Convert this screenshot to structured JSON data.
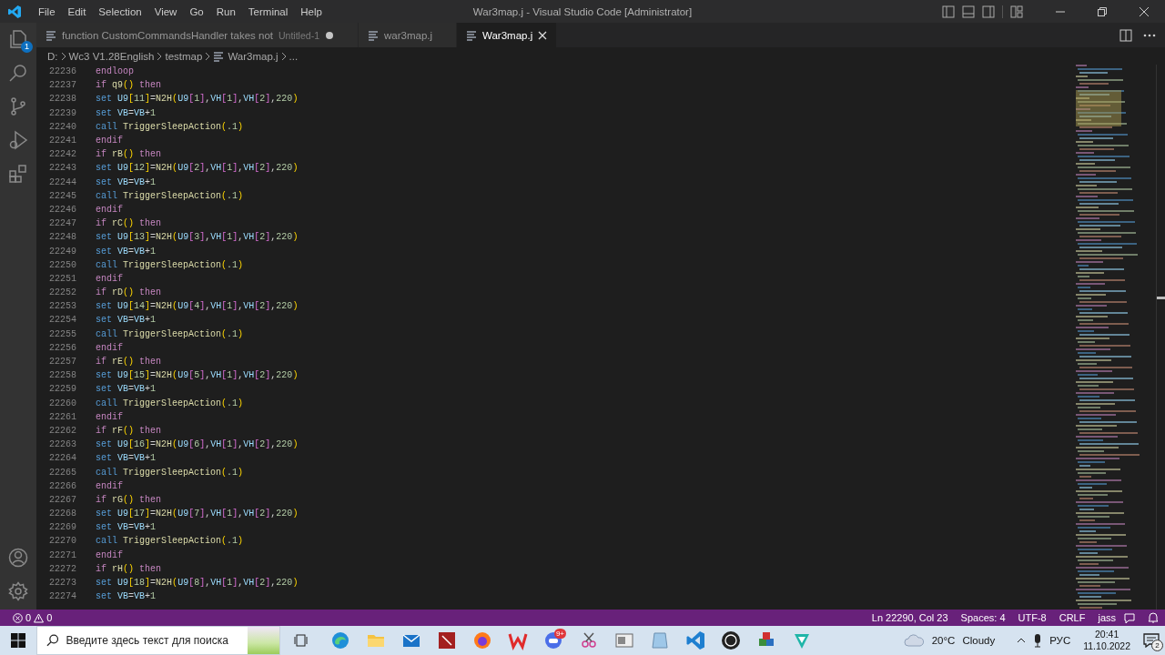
{
  "titlebar": {
    "menu": [
      "File",
      "Edit",
      "Selection",
      "View",
      "Go",
      "Run",
      "Terminal",
      "Help"
    ],
    "title": "War3map.j - Visual Studio Code [Administrator]"
  },
  "activity_bar": {
    "explorer_badge": "1"
  },
  "tabs": [
    {
      "label": "function CustomCommandsHandler takes not",
      "description": "Untitled-1",
      "dirty": true,
      "selected": false
    },
    {
      "label": "war3map.j",
      "dirty": false,
      "selected": false
    },
    {
      "label": "War3map.j",
      "dirty": false,
      "selected": true
    }
  ],
  "breadcrumb": [
    {
      "kind": "folder",
      "text": "D:"
    },
    {
      "kind": "folder",
      "text": "Wc3 V1.28English"
    },
    {
      "kind": "folder",
      "text": "testmap"
    },
    {
      "kind": "file",
      "text": "War3map.j"
    },
    {
      "kind": "more",
      "text": "..."
    }
  ],
  "editor": {
    "lines": [
      {
        "number": "22236",
        "tokens": [
          {
            "kind": "ctl",
            "text": "endloop"
          }
        ]
      },
      {
        "number": "22237",
        "tokens": [
          {
            "kind": "ctl",
            "text": "if "
          },
          {
            "kind": "fn",
            "text": "q9"
          },
          {
            "kind": "br1",
            "text": "()"
          },
          {
            "kind": "ctl",
            "text": " then"
          }
        ]
      },
      {
        "number": "22238",
        "tokens": [
          {
            "kind": "kw",
            "text": "set "
          },
          {
            "kind": "var",
            "text": "U9"
          },
          {
            "kind": "br1",
            "text": "["
          },
          {
            "kind": "num",
            "text": "11"
          },
          {
            "kind": "br1",
            "text": "]"
          },
          {
            "kind": "op",
            "text": "="
          },
          {
            "kind": "fn",
            "text": "N2H"
          },
          {
            "kind": "br1",
            "text": "("
          },
          {
            "kind": "var",
            "text": "U9"
          },
          {
            "kind": "br2",
            "text": "["
          },
          {
            "kind": "num",
            "text": "1"
          },
          {
            "kind": "br2",
            "text": "]"
          },
          {
            "kind": "op",
            "text": ","
          },
          {
            "kind": "var",
            "text": "VH"
          },
          {
            "kind": "br2",
            "text": "["
          },
          {
            "kind": "num",
            "text": "1"
          },
          {
            "kind": "br2",
            "text": "]"
          },
          {
            "kind": "op",
            "text": ","
          },
          {
            "kind": "var",
            "text": "VH"
          },
          {
            "kind": "br2",
            "text": "["
          },
          {
            "kind": "num",
            "text": "2"
          },
          {
            "kind": "br2",
            "text": "]"
          },
          {
            "kind": "op",
            "text": ","
          },
          {
            "kind": "num",
            "text": "220"
          },
          {
            "kind": "br1",
            "text": ")"
          }
        ]
      },
      {
        "number": "22239",
        "tokens": [
          {
            "kind": "kw",
            "text": "set "
          },
          {
            "kind": "var",
            "text": "VB"
          },
          {
            "kind": "op",
            "text": "="
          },
          {
            "kind": "var",
            "text": "VB"
          },
          {
            "kind": "op",
            "text": "+"
          },
          {
            "kind": "num",
            "text": "1"
          }
        ]
      },
      {
        "number": "22240",
        "tokens": [
          {
            "kind": "kw",
            "text": "call "
          },
          {
            "kind": "fn",
            "text": "TriggerSleepAction"
          },
          {
            "kind": "br1",
            "text": "("
          },
          {
            "kind": "num",
            "text": ".1"
          },
          {
            "kind": "br1",
            "text": ")"
          }
        ]
      },
      {
        "number": "22241",
        "tokens": [
          {
            "kind": "ctl",
            "text": "endif"
          }
        ]
      },
      {
        "number": "22242",
        "tokens": [
          {
            "kind": "ctl",
            "text": "if "
          },
          {
            "kind": "fn",
            "text": "rB"
          },
          {
            "kind": "br1",
            "text": "()"
          },
          {
            "kind": "ctl",
            "text": " then"
          }
        ]
      },
      {
        "number": "22243",
        "tokens": [
          {
            "kind": "kw",
            "text": "set "
          },
          {
            "kind": "var",
            "text": "U9"
          },
          {
            "kind": "br1",
            "text": "["
          },
          {
            "kind": "num",
            "text": "12"
          },
          {
            "kind": "br1",
            "text": "]"
          },
          {
            "kind": "op",
            "text": "="
          },
          {
            "kind": "fn",
            "text": "N2H"
          },
          {
            "kind": "br1",
            "text": "("
          },
          {
            "kind": "var",
            "text": "U9"
          },
          {
            "kind": "br2",
            "text": "["
          },
          {
            "kind": "num",
            "text": "2"
          },
          {
            "kind": "br2",
            "text": "]"
          },
          {
            "kind": "op",
            "text": ","
          },
          {
            "kind": "var",
            "text": "VH"
          },
          {
            "kind": "br2",
            "text": "["
          },
          {
            "kind": "num",
            "text": "1"
          },
          {
            "kind": "br2",
            "text": "]"
          },
          {
            "kind": "op",
            "text": ","
          },
          {
            "kind": "var",
            "text": "VH"
          },
          {
            "kind": "br2",
            "text": "["
          },
          {
            "kind": "num",
            "text": "2"
          },
          {
            "kind": "br2",
            "text": "]"
          },
          {
            "kind": "op",
            "text": ","
          },
          {
            "kind": "num",
            "text": "220"
          },
          {
            "kind": "br1",
            "text": ")"
          }
        ]
      },
      {
        "number": "22244",
        "tokens": [
          {
            "kind": "kw",
            "text": "set "
          },
          {
            "kind": "var",
            "text": "VB"
          },
          {
            "kind": "op",
            "text": "="
          },
          {
            "kind": "var",
            "text": "VB"
          },
          {
            "kind": "op",
            "text": "+"
          },
          {
            "kind": "num",
            "text": "1"
          }
        ]
      },
      {
        "number": "22245",
        "tokens": [
          {
            "kind": "kw",
            "text": "call "
          },
          {
            "kind": "fn",
            "text": "TriggerSleepAction"
          },
          {
            "kind": "br1",
            "text": "("
          },
          {
            "kind": "num",
            "text": ".1"
          },
          {
            "kind": "br1",
            "text": ")"
          }
        ]
      },
      {
        "number": "22246",
        "tokens": [
          {
            "kind": "ctl",
            "text": "endif"
          }
        ]
      },
      {
        "number": "22247",
        "tokens": [
          {
            "kind": "ctl",
            "text": "if "
          },
          {
            "kind": "fn",
            "text": "rC"
          },
          {
            "kind": "br1",
            "text": "()"
          },
          {
            "kind": "ctl",
            "text": " then"
          }
        ]
      },
      {
        "number": "22248",
        "tokens": [
          {
            "kind": "kw",
            "text": "set "
          },
          {
            "kind": "var",
            "text": "U9"
          },
          {
            "kind": "br1",
            "text": "["
          },
          {
            "kind": "num",
            "text": "13"
          },
          {
            "kind": "br1",
            "text": "]"
          },
          {
            "kind": "op",
            "text": "="
          },
          {
            "kind": "fn",
            "text": "N2H"
          },
          {
            "kind": "br1",
            "text": "("
          },
          {
            "kind": "var",
            "text": "U9"
          },
          {
            "kind": "br2",
            "text": "["
          },
          {
            "kind": "num",
            "text": "3"
          },
          {
            "kind": "br2",
            "text": "]"
          },
          {
            "kind": "op",
            "text": ","
          },
          {
            "kind": "var",
            "text": "VH"
          },
          {
            "kind": "br2",
            "text": "["
          },
          {
            "kind": "num",
            "text": "1"
          },
          {
            "kind": "br2",
            "text": "]"
          },
          {
            "kind": "op",
            "text": ","
          },
          {
            "kind": "var",
            "text": "VH"
          },
          {
            "kind": "br2",
            "text": "["
          },
          {
            "kind": "num",
            "text": "2"
          },
          {
            "kind": "br2",
            "text": "]"
          },
          {
            "kind": "op",
            "text": ","
          },
          {
            "kind": "num",
            "text": "220"
          },
          {
            "kind": "br1",
            "text": ")"
          }
        ]
      },
      {
        "number": "22249",
        "tokens": [
          {
            "kind": "kw",
            "text": "set "
          },
          {
            "kind": "var",
            "text": "VB"
          },
          {
            "kind": "op",
            "text": "="
          },
          {
            "kind": "var",
            "text": "VB"
          },
          {
            "kind": "op",
            "text": "+"
          },
          {
            "kind": "num",
            "text": "1"
          }
        ]
      },
      {
        "number": "22250",
        "tokens": [
          {
            "kind": "kw",
            "text": "call "
          },
          {
            "kind": "fn",
            "text": "TriggerSleepAction"
          },
          {
            "kind": "br1",
            "text": "("
          },
          {
            "kind": "num",
            "text": ".1"
          },
          {
            "kind": "br1",
            "text": ")"
          }
        ]
      },
      {
        "number": "22251",
        "tokens": [
          {
            "kind": "ctl",
            "text": "endif"
          }
        ]
      },
      {
        "number": "22252",
        "tokens": [
          {
            "kind": "ctl",
            "text": "if "
          },
          {
            "kind": "fn",
            "text": "rD"
          },
          {
            "kind": "br1",
            "text": "()"
          },
          {
            "kind": "ctl",
            "text": " then"
          }
        ]
      },
      {
        "number": "22253",
        "tokens": [
          {
            "kind": "kw",
            "text": "set "
          },
          {
            "kind": "var",
            "text": "U9"
          },
          {
            "kind": "br1",
            "text": "["
          },
          {
            "kind": "num",
            "text": "14"
          },
          {
            "kind": "br1",
            "text": "]"
          },
          {
            "kind": "op",
            "text": "="
          },
          {
            "kind": "fn",
            "text": "N2H"
          },
          {
            "kind": "br1",
            "text": "("
          },
          {
            "kind": "var",
            "text": "U9"
          },
          {
            "kind": "br2",
            "text": "["
          },
          {
            "kind": "num",
            "text": "4"
          },
          {
            "kind": "br2",
            "text": "]"
          },
          {
            "kind": "op",
            "text": ","
          },
          {
            "kind": "var",
            "text": "VH"
          },
          {
            "kind": "br2",
            "text": "["
          },
          {
            "kind": "num",
            "text": "1"
          },
          {
            "kind": "br2",
            "text": "]"
          },
          {
            "kind": "op",
            "text": ","
          },
          {
            "kind": "var",
            "text": "VH"
          },
          {
            "kind": "br2",
            "text": "["
          },
          {
            "kind": "num",
            "text": "2"
          },
          {
            "kind": "br2",
            "text": "]"
          },
          {
            "kind": "op",
            "text": ","
          },
          {
            "kind": "num",
            "text": "220"
          },
          {
            "kind": "br1",
            "text": ")"
          }
        ]
      },
      {
        "number": "22254",
        "tokens": [
          {
            "kind": "kw",
            "text": "set "
          },
          {
            "kind": "var",
            "text": "VB"
          },
          {
            "kind": "op",
            "text": "="
          },
          {
            "kind": "var",
            "text": "VB"
          },
          {
            "kind": "op",
            "text": "+"
          },
          {
            "kind": "num",
            "text": "1"
          }
        ]
      },
      {
        "number": "22255",
        "tokens": [
          {
            "kind": "kw",
            "text": "call "
          },
          {
            "kind": "fn",
            "text": "TriggerSleepAction"
          },
          {
            "kind": "br1",
            "text": "("
          },
          {
            "kind": "num",
            "text": ".1"
          },
          {
            "kind": "br1",
            "text": ")"
          }
        ]
      },
      {
        "number": "22256",
        "tokens": [
          {
            "kind": "ctl",
            "text": "endif"
          }
        ]
      },
      {
        "number": "22257",
        "tokens": [
          {
            "kind": "ctl",
            "text": "if "
          },
          {
            "kind": "fn",
            "text": "rE"
          },
          {
            "kind": "br1",
            "text": "()"
          },
          {
            "kind": "ctl",
            "text": " then"
          }
        ]
      },
      {
        "number": "22258",
        "tokens": [
          {
            "kind": "kw",
            "text": "set "
          },
          {
            "kind": "var",
            "text": "U9"
          },
          {
            "kind": "br1",
            "text": "["
          },
          {
            "kind": "num",
            "text": "15"
          },
          {
            "kind": "br1",
            "text": "]"
          },
          {
            "kind": "op",
            "text": "="
          },
          {
            "kind": "fn",
            "text": "N2H"
          },
          {
            "kind": "br1",
            "text": "("
          },
          {
            "kind": "var",
            "text": "U9"
          },
          {
            "kind": "br2",
            "text": "["
          },
          {
            "kind": "num",
            "text": "5"
          },
          {
            "kind": "br2",
            "text": "]"
          },
          {
            "kind": "op",
            "text": ","
          },
          {
            "kind": "var",
            "text": "VH"
          },
          {
            "kind": "br2",
            "text": "["
          },
          {
            "kind": "num",
            "text": "1"
          },
          {
            "kind": "br2",
            "text": "]"
          },
          {
            "kind": "op",
            "text": ","
          },
          {
            "kind": "var",
            "text": "VH"
          },
          {
            "kind": "br2",
            "text": "["
          },
          {
            "kind": "num",
            "text": "2"
          },
          {
            "kind": "br2",
            "text": "]"
          },
          {
            "kind": "op",
            "text": ","
          },
          {
            "kind": "num",
            "text": "220"
          },
          {
            "kind": "br1",
            "text": ")"
          }
        ]
      },
      {
        "number": "22259",
        "tokens": [
          {
            "kind": "kw",
            "text": "set "
          },
          {
            "kind": "var",
            "text": "VB"
          },
          {
            "kind": "op",
            "text": "="
          },
          {
            "kind": "var",
            "text": "VB"
          },
          {
            "kind": "op",
            "text": "+"
          },
          {
            "kind": "num",
            "text": "1"
          }
        ]
      },
      {
        "number": "22260",
        "tokens": [
          {
            "kind": "kw",
            "text": "call "
          },
          {
            "kind": "fn",
            "text": "TriggerSleepAction"
          },
          {
            "kind": "br1",
            "text": "("
          },
          {
            "kind": "num",
            "text": ".1"
          },
          {
            "kind": "br1",
            "text": ")"
          }
        ]
      },
      {
        "number": "22261",
        "tokens": [
          {
            "kind": "ctl",
            "text": "endif"
          }
        ]
      },
      {
        "number": "22262",
        "tokens": [
          {
            "kind": "ctl",
            "text": "if "
          },
          {
            "kind": "fn",
            "text": "rF"
          },
          {
            "kind": "br1",
            "text": "()"
          },
          {
            "kind": "ctl",
            "text": " then"
          }
        ]
      },
      {
        "number": "22263",
        "tokens": [
          {
            "kind": "kw",
            "text": "set "
          },
          {
            "kind": "var",
            "text": "U9"
          },
          {
            "kind": "br1",
            "text": "["
          },
          {
            "kind": "num",
            "text": "16"
          },
          {
            "kind": "br1",
            "text": "]"
          },
          {
            "kind": "op",
            "text": "="
          },
          {
            "kind": "fn",
            "text": "N2H"
          },
          {
            "kind": "br1",
            "text": "("
          },
          {
            "kind": "var",
            "text": "U9"
          },
          {
            "kind": "br2",
            "text": "["
          },
          {
            "kind": "num",
            "text": "6"
          },
          {
            "kind": "br2",
            "text": "]"
          },
          {
            "kind": "op",
            "text": ","
          },
          {
            "kind": "var",
            "text": "VH"
          },
          {
            "kind": "br2",
            "text": "["
          },
          {
            "kind": "num",
            "text": "1"
          },
          {
            "kind": "br2",
            "text": "]"
          },
          {
            "kind": "op",
            "text": ","
          },
          {
            "kind": "var",
            "text": "VH"
          },
          {
            "kind": "br2",
            "text": "["
          },
          {
            "kind": "num",
            "text": "2"
          },
          {
            "kind": "br2",
            "text": "]"
          },
          {
            "kind": "op",
            "text": ","
          },
          {
            "kind": "num",
            "text": "220"
          },
          {
            "kind": "br1",
            "text": ")"
          }
        ]
      },
      {
        "number": "22264",
        "tokens": [
          {
            "kind": "kw",
            "text": "set "
          },
          {
            "kind": "var",
            "text": "VB"
          },
          {
            "kind": "op",
            "text": "="
          },
          {
            "kind": "var",
            "text": "VB"
          },
          {
            "kind": "op",
            "text": "+"
          },
          {
            "kind": "num",
            "text": "1"
          }
        ]
      },
      {
        "number": "22265",
        "tokens": [
          {
            "kind": "kw",
            "text": "call "
          },
          {
            "kind": "fn",
            "text": "TriggerSleepAction"
          },
          {
            "kind": "br1",
            "text": "("
          },
          {
            "kind": "num",
            "text": ".1"
          },
          {
            "kind": "br1",
            "text": ")"
          }
        ]
      },
      {
        "number": "22266",
        "tokens": [
          {
            "kind": "ctl",
            "text": "endif"
          }
        ]
      },
      {
        "number": "22267",
        "tokens": [
          {
            "kind": "ctl",
            "text": "if "
          },
          {
            "kind": "fn",
            "text": "rG"
          },
          {
            "kind": "br1",
            "text": "()"
          },
          {
            "kind": "ctl",
            "text": " then"
          }
        ]
      },
      {
        "number": "22268",
        "tokens": [
          {
            "kind": "kw",
            "text": "set "
          },
          {
            "kind": "var",
            "text": "U9"
          },
          {
            "kind": "br1",
            "text": "["
          },
          {
            "kind": "num",
            "text": "17"
          },
          {
            "kind": "br1",
            "text": "]"
          },
          {
            "kind": "op",
            "text": "="
          },
          {
            "kind": "fn",
            "text": "N2H"
          },
          {
            "kind": "br1",
            "text": "("
          },
          {
            "kind": "var",
            "text": "U9"
          },
          {
            "kind": "br2",
            "text": "["
          },
          {
            "kind": "num",
            "text": "7"
          },
          {
            "kind": "br2",
            "text": "]"
          },
          {
            "kind": "op",
            "text": ","
          },
          {
            "kind": "var",
            "text": "VH"
          },
          {
            "kind": "br2",
            "text": "["
          },
          {
            "kind": "num",
            "text": "1"
          },
          {
            "kind": "br2",
            "text": "]"
          },
          {
            "kind": "op",
            "text": ","
          },
          {
            "kind": "var",
            "text": "VH"
          },
          {
            "kind": "br2",
            "text": "["
          },
          {
            "kind": "num",
            "text": "2"
          },
          {
            "kind": "br2",
            "text": "]"
          },
          {
            "kind": "op",
            "text": ","
          },
          {
            "kind": "num",
            "text": "220"
          },
          {
            "kind": "br1",
            "text": ")"
          }
        ]
      },
      {
        "number": "22269",
        "tokens": [
          {
            "kind": "kw",
            "text": "set "
          },
          {
            "kind": "var",
            "text": "VB"
          },
          {
            "kind": "op",
            "text": "="
          },
          {
            "kind": "var",
            "text": "VB"
          },
          {
            "kind": "op",
            "text": "+"
          },
          {
            "kind": "num",
            "text": "1"
          }
        ]
      },
      {
        "number": "22270",
        "tokens": [
          {
            "kind": "kw",
            "text": "call "
          },
          {
            "kind": "fn",
            "text": "TriggerSleepAction"
          },
          {
            "kind": "br1",
            "text": "("
          },
          {
            "kind": "num",
            "text": ".1"
          },
          {
            "kind": "br1",
            "text": ")"
          }
        ]
      },
      {
        "number": "22271",
        "tokens": [
          {
            "kind": "ctl",
            "text": "endif"
          }
        ]
      },
      {
        "number": "22272",
        "tokens": [
          {
            "kind": "ctl",
            "text": "if "
          },
          {
            "kind": "fn",
            "text": "rH"
          },
          {
            "kind": "br1",
            "text": "()"
          },
          {
            "kind": "ctl",
            "text": " then"
          }
        ]
      },
      {
        "number": "22273",
        "tokens": [
          {
            "kind": "kw",
            "text": "set "
          },
          {
            "kind": "var",
            "text": "U9"
          },
          {
            "kind": "br1",
            "text": "["
          },
          {
            "kind": "num",
            "text": "18"
          },
          {
            "kind": "br1",
            "text": "]"
          },
          {
            "kind": "op",
            "text": "="
          },
          {
            "kind": "fn",
            "text": "N2H"
          },
          {
            "kind": "br1",
            "text": "("
          },
          {
            "kind": "var",
            "text": "U9"
          },
          {
            "kind": "br2",
            "text": "["
          },
          {
            "kind": "num",
            "text": "8"
          },
          {
            "kind": "br2",
            "text": "]"
          },
          {
            "kind": "op",
            "text": ","
          },
          {
            "kind": "var",
            "text": "VH"
          },
          {
            "kind": "br2",
            "text": "["
          },
          {
            "kind": "num",
            "text": "1"
          },
          {
            "kind": "br2",
            "text": "]"
          },
          {
            "kind": "op",
            "text": ","
          },
          {
            "kind": "var",
            "text": "VH"
          },
          {
            "kind": "br2",
            "text": "["
          },
          {
            "kind": "num",
            "text": "2"
          },
          {
            "kind": "br2",
            "text": "]"
          },
          {
            "kind": "op",
            "text": ","
          },
          {
            "kind": "num",
            "text": "220"
          },
          {
            "kind": "br1",
            "text": ")"
          }
        ]
      },
      {
        "number": "22274",
        "tokens": [
          {
            "kind": "kw",
            "text": "set "
          },
          {
            "kind": "var",
            "text": "VB"
          },
          {
            "kind": "op",
            "text": "="
          },
          {
            "kind": "var",
            "text": "VB"
          },
          {
            "kind": "op",
            "text": "+"
          },
          {
            "kind": "num",
            "text": "1"
          }
        ]
      }
    ]
  },
  "status_bar": {
    "errors": "0",
    "warnings": "0",
    "items": [
      "Ln 22290, Col 23",
      "Spaces: 4",
      "UTF-8",
      "CRLF",
      "jass"
    ]
  },
  "taskbar": {
    "search": {
      "placeholder": "Введите здесь текст для поиска"
    },
    "app_badge": "9+",
    "weather": {
      "temperature": "20°C",
      "condition": "Cloudy"
    },
    "language": "РУС",
    "time": "20:41",
    "date": "11.10.2022",
    "notifications": "2"
  }
}
